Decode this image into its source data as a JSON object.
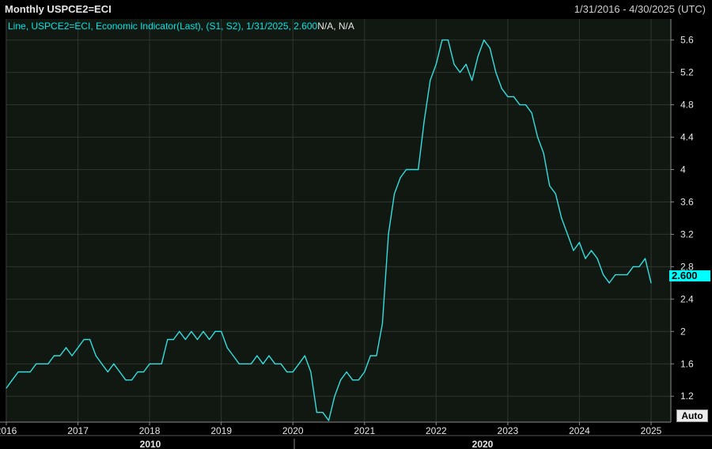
{
  "header": {
    "title": "Monthly USPCE2=ECI",
    "date_range": "1/31/2016 - 4/30/2025 (UTC)"
  },
  "legend": {
    "text": "Line, USPCE2=ECI, Economic Indicator(Last), (S1, S2),  1/31/2025, 2.600",
    "suffix": "N/A, N/A"
  },
  "last_value_label": "2.600",
  "auto_button": "Auto",
  "colors": {
    "line": "#33dede",
    "background": "#111811",
    "grid": "#2e352e",
    "text": "#e6e6e6",
    "last_box": "#00ffff"
  },
  "chart_data": {
    "type": "line",
    "title": "Monthly USPCE2=ECI",
    "series": [
      {
        "name": "USPCE2=ECI",
        "x": [
          "2016-01",
          "2016-02",
          "2016-03",
          "2016-04",
          "2016-05",
          "2016-06",
          "2016-07",
          "2016-08",
          "2016-09",
          "2016-10",
          "2016-11",
          "2016-12",
          "2017-01",
          "2017-02",
          "2017-03",
          "2017-04",
          "2017-05",
          "2017-06",
          "2017-07",
          "2017-08",
          "2017-09",
          "2017-10",
          "2017-11",
          "2017-12",
          "2018-01",
          "2018-02",
          "2018-03",
          "2018-04",
          "2018-05",
          "2018-06",
          "2018-07",
          "2018-08",
          "2018-09",
          "2018-10",
          "2018-11",
          "2018-12",
          "2019-01",
          "2019-02",
          "2019-03",
          "2019-04",
          "2019-05",
          "2019-06",
          "2019-07",
          "2019-08",
          "2019-09",
          "2019-10",
          "2019-11",
          "2019-12",
          "2020-01",
          "2020-02",
          "2020-03",
          "2020-04",
          "2020-05",
          "2020-06",
          "2020-07",
          "2020-08",
          "2020-09",
          "2020-10",
          "2020-11",
          "2020-12",
          "2021-01",
          "2021-02",
          "2021-03",
          "2021-04",
          "2021-05",
          "2021-06",
          "2021-07",
          "2021-08",
          "2021-09",
          "2021-10",
          "2021-11",
          "2021-12",
          "2022-01",
          "2022-02",
          "2022-03",
          "2022-04",
          "2022-05",
          "2022-06",
          "2022-07",
          "2022-08",
          "2022-09",
          "2022-10",
          "2022-11",
          "2022-12",
          "2023-01",
          "2023-02",
          "2023-03",
          "2023-04",
          "2023-05",
          "2023-06",
          "2023-07",
          "2023-08",
          "2023-09",
          "2023-10",
          "2023-11",
          "2023-12",
          "2024-01",
          "2024-02",
          "2024-03",
          "2024-04",
          "2024-05",
          "2024-06",
          "2024-07",
          "2024-08",
          "2024-09",
          "2024-10",
          "2024-11",
          "2024-12",
          "2025-01"
        ],
        "values": [
          1.3,
          1.4,
          1.5,
          1.5,
          1.5,
          1.6,
          1.6,
          1.6,
          1.7,
          1.7,
          1.8,
          1.7,
          1.8,
          1.9,
          1.9,
          1.7,
          1.6,
          1.5,
          1.6,
          1.5,
          1.4,
          1.4,
          1.5,
          1.5,
          1.6,
          1.6,
          1.6,
          1.9,
          1.9,
          2.0,
          1.9,
          2.0,
          1.9,
          2.0,
          1.9,
          2.0,
          2.0,
          1.8,
          1.7,
          1.6,
          1.6,
          1.6,
          1.7,
          1.6,
          1.7,
          1.6,
          1.6,
          1.5,
          1.5,
          1.6,
          1.7,
          1.5,
          1.0,
          1.0,
          0.9,
          1.2,
          1.4,
          1.5,
          1.4,
          1.4,
          1.5,
          1.7,
          1.7,
          2.1,
          3.2,
          3.7,
          3.9,
          4.0,
          4.0,
          4.0,
          4.6,
          5.1,
          5.3,
          5.6,
          5.6,
          5.3,
          5.2,
          5.3,
          5.1,
          5.4,
          5.6,
          5.5,
          5.2,
          5.0,
          4.9,
          4.9,
          4.8,
          4.8,
          4.7,
          4.4,
          4.2,
          3.8,
          3.7,
          3.4,
          3.2,
          3.0,
          3.1,
          2.9,
          3.0,
          2.9,
          2.7,
          2.6,
          2.7,
          2.7,
          2.7,
          2.8,
          2.8,
          2.9,
          2.6
        ]
      }
    ],
    "x_ticks": [
      "2016",
      "2017",
      "2018",
      "2019",
      "2020",
      "2021",
      "2022",
      "2023",
      "2024",
      "2025"
    ],
    "x_decade_labels": [
      "2010",
      "2020"
    ],
    "y_ticks": [
      "1.2",
      "1.6",
      "2",
      "2.4",
      "2.8",
      "3.2",
      "3.6",
      "4",
      "4.4",
      "4.8",
      "5.2",
      "5.6"
    ],
    "ylim": [
      0.8,
      5.9
    ],
    "grid": true,
    "y_axis_position": "right"
  }
}
